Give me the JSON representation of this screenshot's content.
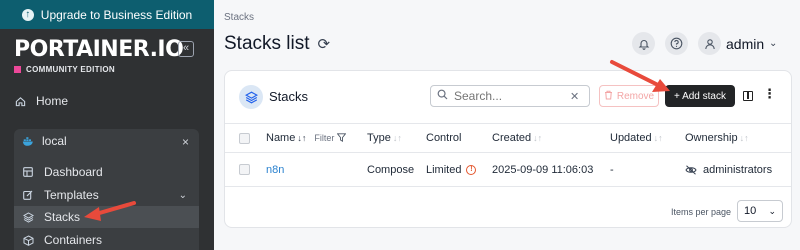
{
  "upgrade": {
    "label": "Upgrade to Business Edition"
  },
  "brand": {
    "logo_text": "PORTAINER.IO",
    "edition": "COMMUNITY EDITION",
    "collapse_glyph": "«"
  },
  "sidebar": {
    "home": "Home",
    "environment": {
      "name": "local",
      "close": "×"
    },
    "items": [
      {
        "label": "Dashboard",
        "icon": "dashboard-icon"
      },
      {
        "label": "Templates",
        "icon": "edit-icon",
        "chevron": "⌄"
      },
      {
        "label": "Stacks",
        "icon": "layers-icon",
        "active": true
      },
      {
        "label": "Containers",
        "icon": "box-icon"
      }
    ]
  },
  "header": {
    "breadcrumb": "Stacks",
    "title": "Stacks list",
    "user": "admin"
  },
  "panel": {
    "title": "Stacks",
    "search_placeholder": "Search...",
    "remove_label": "Remove",
    "add_label": "+ Add stack",
    "columns": [
      "Name",
      "Filter",
      "Type",
      "Control",
      "Created",
      "Updated",
      "Ownership"
    ],
    "rows": [
      {
        "name": "n8n",
        "type": "Compose",
        "control": "Limited",
        "created": "2025-09-09 11:06:03",
        "updated": "-",
        "ownership": "administrators"
      }
    ],
    "pager": {
      "label": "Items per page",
      "value": "10"
    }
  },
  "colors": {
    "sidebar_bg": "#2f3133",
    "upgrade_bg": "#0d5e6f",
    "link": "#2b82cf",
    "warning": "#e4572e",
    "annotation_arrow": "#e84a3b"
  }
}
